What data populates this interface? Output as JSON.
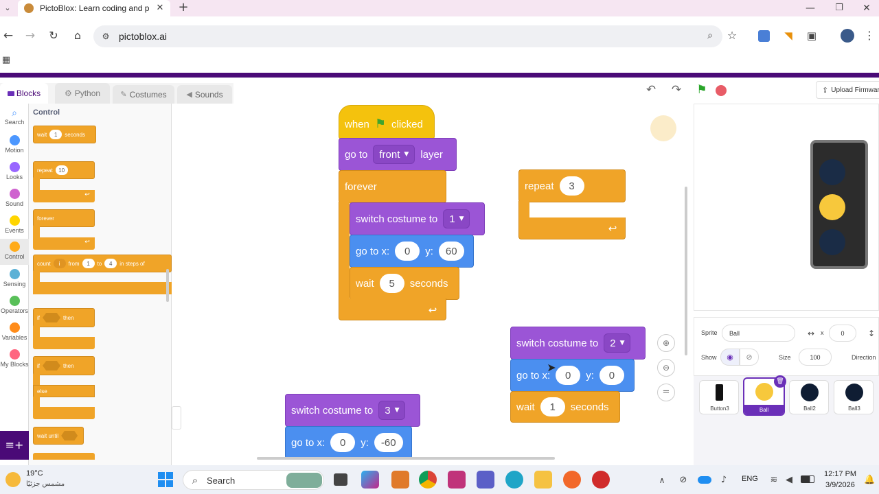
{
  "browser": {
    "tab_title": "PictoBlox: Learn coding and pro",
    "url": "pictoblox.ai"
  },
  "editor_tabs": [
    {
      "label": "Blocks"
    },
    {
      "label": "Python"
    },
    {
      "label": "Costumes"
    },
    {
      "label": "Sounds"
    }
  ],
  "upload_label": "Upload Firmwar",
  "categories": [
    {
      "label": "Search",
      "color": "#4c97ff"
    },
    {
      "label": "Motion",
      "color": "#4c97ff"
    },
    {
      "label": "Looks",
      "color": "#9966ff"
    },
    {
      "label": "Sound",
      "color": "#cf63cf"
    },
    {
      "label": "Events",
      "color": "#ffd500"
    },
    {
      "label": "Control",
      "color": "#ffab19"
    },
    {
      "label": "Sensing",
      "color": "#5cb1d6"
    },
    {
      "label": "Operators",
      "color": "#59c059"
    },
    {
      "label": "Variables",
      "color": "#ff8c1a"
    },
    {
      "label": "My Blocks",
      "color": "#ff6680"
    }
  ],
  "palette": {
    "heading": "Control",
    "wait": {
      "t1": "wait",
      "v": "1",
      "t2": "seconds"
    },
    "repeat": {
      "t1": "repeat",
      "v": "10"
    },
    "forever": "forever",
    "count": {
      "t1": "count",
      "var": "i",
      "t2": "from",
      "v1": "1",
      "t3": "to",
      "v2": "4",
      "t4": "in steps of"
    },
    "if_then": {
      "t1": "if",
      "t2": "then"
    },
    "if_else": {
      "t1": "if",
      "t2": "then",
      "t3": "else"
    },
    "wait_until": "wait until"
  },
  "script1": {
    "hat": {
      "t1": "when",
      "t2": "clicked"
    },
    "goto_layer": {
      "t1": "go to",
      "opt": "front",
      "t2": "layer"
    },
    "forever": "forever",
    "switch": {
      "t1": "switch costume to",
      "v": "1"
    },
    "goxy": {
      "t1": "go to x:",
      "x": "0",
      "t2": "y:",
      "y": "60"
    },
    "wait": {
      "t1": "wait",
      "v": "5",
      "t2": "seconds"
    }
  },
  "script2": {
    "t1": "repeat",
    "v": "3"
  },
  "script3": {
    "switch": {
      "t1": "switch costume to",
      "v": "2"
    },
    "goxy": {
      "t1": "go to x:",
      "x": "0",
      "t2": "y:",
      "y": "0"
    },
    "wait": {
      "t1": "wait",
      "v": "1",
      "t2": "seconds"
    }
  },
  "script4": {
    "switch": {
      "t1": "switch costume to",
      "v": "3"
    },
    "goxy": {
      "t1": "go to x:",
      "x": "0",
      "t2": "y:",
      "y": "-60"
    }
  },
  "sprite_panel": {
    "sprite_label": "Sprite",
    "sprite_name": "Ball",
    "x_label": "x",
    "x_value": "0",
    "show_label": "Show",
    "size_label": "Size",
    "size_value": "100",
    "direction_label": "Direction"
  },
  "sprites": [
    {
      "name": "Button3"
    },
    {
      "name": "Ball"
    },
    {
      "name": "Ball2"
    },
    {
      "name": "Ball3"
    }
  ],
  "taskbar": {
    "temp": "19°C",
    "weather": "مشمس جزئيًا",
    "search": "Search",
    "lang": "ENG",
    "time": "12:17 PM",
    "date": "3/9/2026"
  }
}
